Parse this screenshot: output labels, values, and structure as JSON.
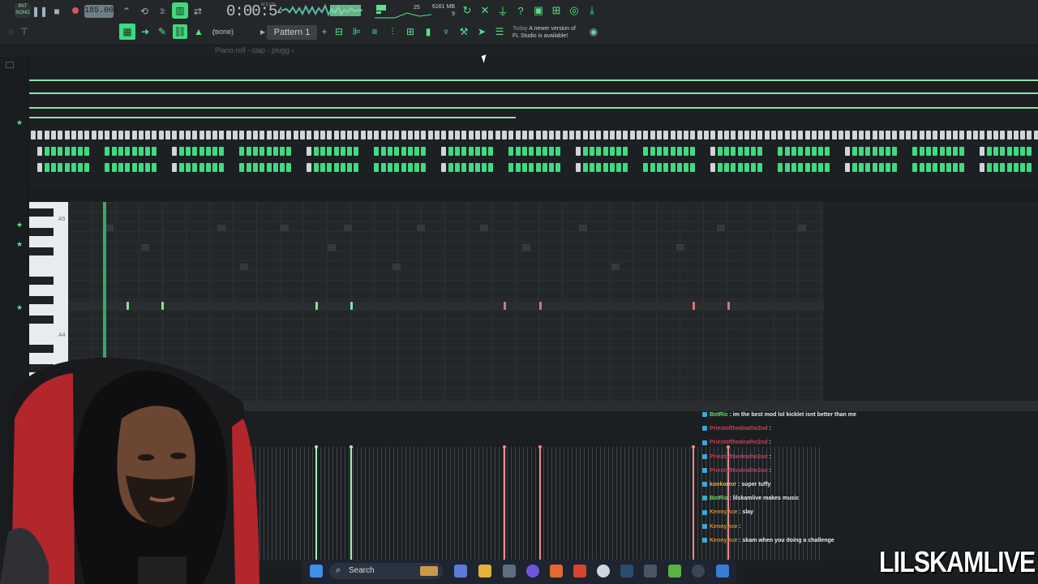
{
  "toolbar": {
    "pat_song": "PAT\nSONG",
    "tempo": "185.000",
    "time": "0:00:54",
    "time_unit": "M:S:CS",
    "cpu_value": "25",
    "memory": "6161 MB",
    "memory_sub": "9",
    "pattern": "Pattern 1",
    "none_select": "(none)",
    "news_date": "Today",
    "news_text_1": "A newer version of",
    "news_text_2": "FL Studio is available!",
    "accent": "#58e38a"
  },
  "piano_roll": {
    "breadcrumb": "Piano roll - clap - plugg ›",
    "key_a5": "A5",
    "key_a4": "A4"
  },
  "chat": [
    {
      "user": "BotRix",
      "text": "im the best mod lol kicklet isnt better than me",
      "color": "#65e06b"
    },
    {
      "user": "Priestofthedeathe2nd",
      "text": "",
      "color": "#d23a55"
    },
    {
      "user": "Priestofthedeathe2nd",
      "text": "",
      "color": "#d23a55"
    },
    {
      "user": "Priestofthedeathe2nd",
      "text": "",
      "color": "#d23a55"
    },
    {
      "user": "Priestofthedeathe2nd",
      "text": "",
      "color": "#d23a55"
    },
    {
      "user": "konkorror",
      "text": "super tuffy",
      "color": "#e3b43b"
    },
    {
      "user": "BotRix",
      "text": "lilskamlive makes music",
      "color": "#65e06b"
    },
    {
      "user": "KennyAce",
      "text": "slay",
      "color": "#d98a2b"
    },
    {
      "user": "KennyAce",
      "text": "",
      "color": "#d98a2b"
    },
    {
      "user": "KennyAce",
      "text": "skam when you doing a challenge",
      "color": "#d98a2b"
    }
  ],
  "taskbar": {
    "search_label": "Search"
  },
  "overlay": {
    "brand": "LILSKAMLIVE"
  }
}
